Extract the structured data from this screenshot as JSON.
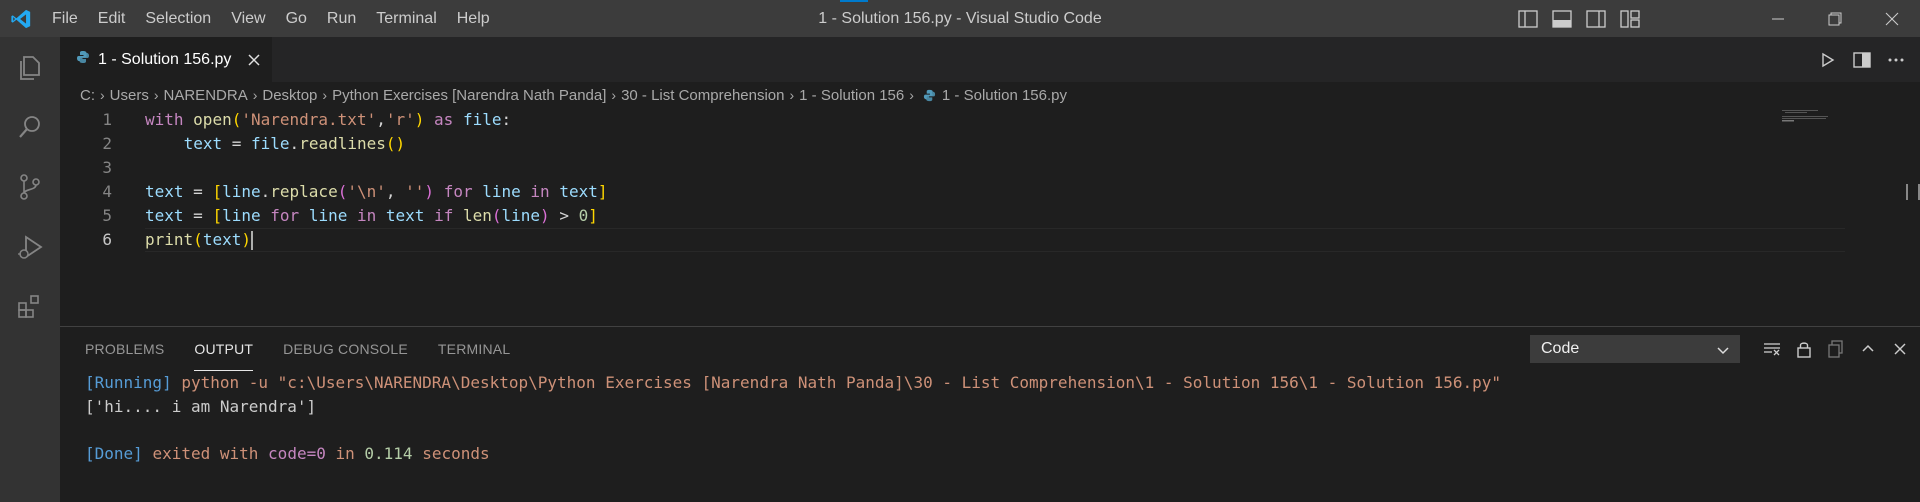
{
  "colors": {
    "titlebar": "#3c3c3c",
    "activitybar": "#333333",
    "editor_bg": "#1e1e1e",
    "accent": "#007acc",
    "keyword": "#c586c0",
    "function": "#dcdcaa",
    "string": "#ce9178",
    "variable": "#9cdcfe",
    "number": "#b5cea8"
  },
  "titlebar": {
    "app_icon": "vscode-logo-icon",
    "menu": [
      "File",
      "Edit",
      "Selection",
      "View",
      "Go",
      "Run",
      "Terminal",
      "Help"
    ],
    "title": "1 - Solution 156.py - Visual Studio Code",
    "layout_icons": [
      "toggle-primary-sidebar-icon",
      "toggle-panel-icon",
      "toggle-secondary-sidebar-icon",
      "customize-layout-icon"
    ],
    "window_controls": [
      "minimize-icon",
      "restore-icon",
      "close-icon"
    ]
  },
  "activitybar": {
    "items": [
      "explorer-icon",
      "search-icon",
      "source-control-icon",
      "run-debug-icon",
      "extensions-icon"
    ]
  },
  "tabs": [
    {
      "label": "1 - Solution 156.py",
      "icon": "python-file-icon",
      "active": true
    }
  ],
  "editor_actions": [
    "run-icon",
    "split-editor-icon",
    "more-actions-icon"
  ],
  "breadcrumb": [
    "C:",
    "Users",
    "NARENDRA",
    "Desktop",
    "Python Exercises [Narendra Nath Panda]",
    "30 - List Comprehension",
    "1 - Solution 156",
    "1 - Solution 156.py"
  ],
  "editor": {
    "line_numbers": [
      "1",
      "2",
      "3",
      "4",
      "5",
      "6"
    ],
    "active_line": 6,
    "code_lines": [
      "with open('Narendra.txt','r') as file:",
      "    text = file.readlines()",
      "",
      "text = [line.replace('\\n', '') for line in text]",
      "text = [line for line in text if len(line) > 0]",
      "print(text)"
    ]
  },
  "panel": {
    "tabs": [
      "PROBLEMS",
      "OUTPUT",
      "DEBUG CONSOLE",
      "TERMINAL"
    ],
    "active_tab": "OUTPUT",
    "output_channel": "Code",
    "actions": [
      "clear-output-icon",
      "lock-scroll-icon",
      "open-output-editor-icon",
      "maximize-panel-icon",
      "close-panel-icon"
    ],
    "output": {
      "running_tag": "[Running]",
      "running_cmd": "python -u \"c:\\Users\\NARENDRA\\Desktop\\Python Exercises [Narendra Nath Panda]\\30 - List Comprehension\\1 - Solution 156\\1 - Solution 156.py\"",
      "result": "['hi.... i am Narendra']",
      "done_tag": "[Done]",
      "done_text_1": "exited with",
      "done_code": "code=0",
      "done_in": "in",
      "done_seconds": "0.114",
      "done_unit": "seconds"
    }
  }
}
